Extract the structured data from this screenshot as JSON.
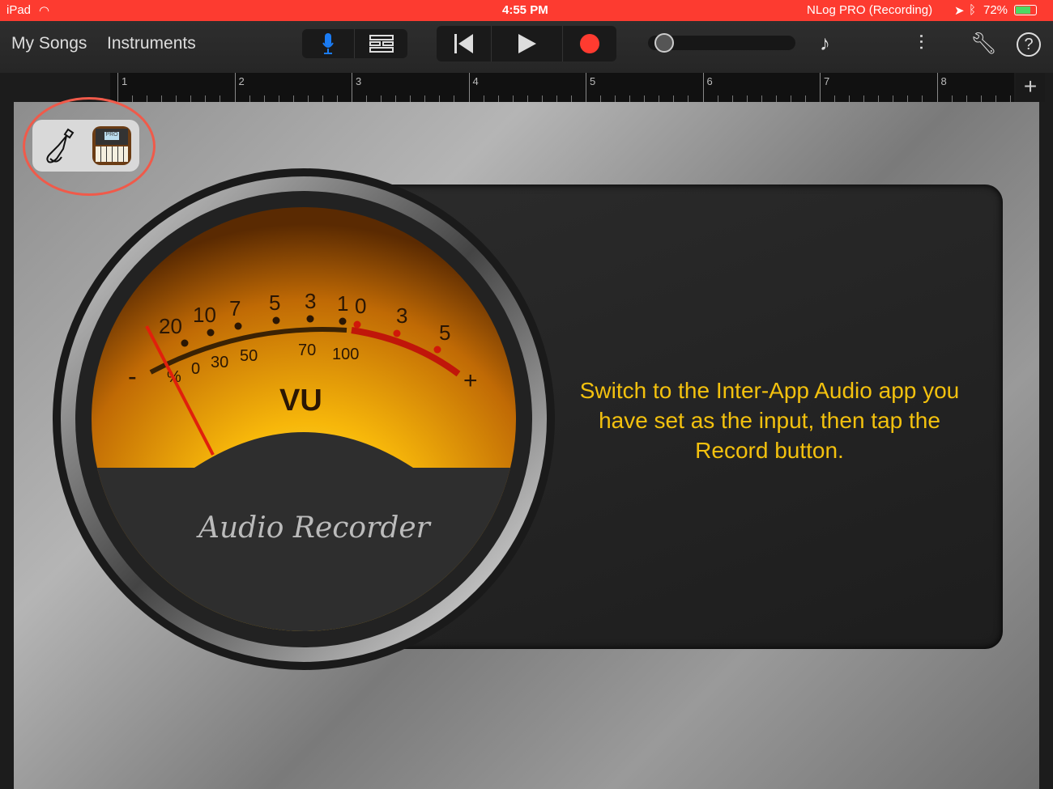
{
  "status_bar": {
    "device": "iPad",
    "time": "4:55 PM",
    "app_status": "NLog PRO (Recording)",
    "battery": "72%"
  },
  "toolbar": {
    "my_songs": "My Songs",
    "instruments": "Instruments"
  },
  "ruler": {
    "bars": [
      "1",
      "2",
      "3",
      "4",
      "5",
      "6",
      "7",
      "8"
    ]
  },
  "input": {
    "selected_app": "PRO"
  },
  "vu_meter": {
    "label": "VU",
    "brand": "Audio Recorder",
    "minus": "-",
    "plus": "+",
    "top_scale": [
      "20",
      "10",
      "7",
      "5",
      "3",
      "1",
      "0",
      "3",
      "5"
    ],
    "bottom_scale": [
      "%",
      "0",
      "30",
      "50",
      "70",
      "100"
    ]
  },
  "message": "Switch to the Inter-App Audio app you have set as the input, then tap the Record button.",
  "colors": {
    "status": "#fd3b30",
    "accent": "#f3c10e",
    "record": "#ff3b30",
    "mic": "#1a7cf5"
  }
}
